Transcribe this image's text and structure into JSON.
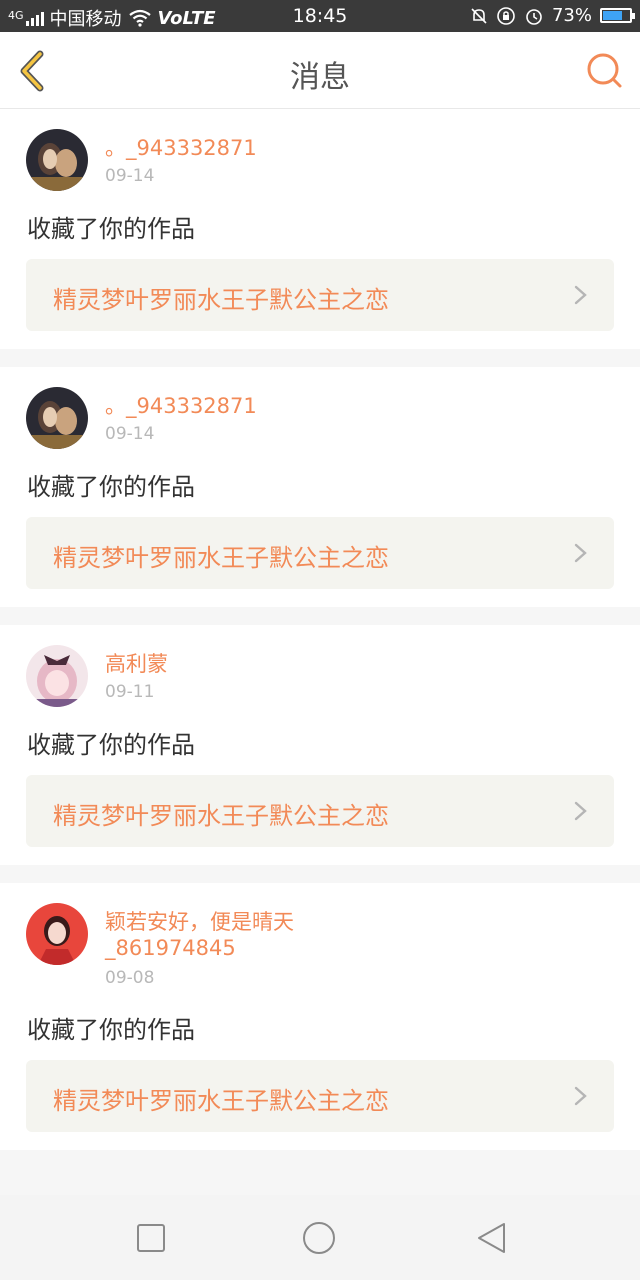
{
  "status_bar": {
    "network_type": "4G",
    "carrier": "中国移动",
    "volte": "VoLTE",
    "time": "18:45",
    "battery_percent": "73%",
    "battery_level": 0.73,
    "icons": [
      "signal-icon",
      "wifi-icon",
      "mute-icon",
      "rotation-lock-icon",
      "alarm-icon",
      "battery-icon"
    ]
  },
  "header": {
    "title": "消息",
    "back_icon": "chevron-left-icon",
    "search_icon": "search-icon"
  },
  "messages": [
    {
      "user": "。_943332871",
      "date": "09-14",
      "action": "收藏了你的作品",
      "work_title": "精灵梦叶罗丽水王子默公主之恋"
    },
    {
      "user": "。_943332871",
      "date": "09-14",
      "action": "收藏了你的作品",
      "work_title": "精灵梦叶罗丽水王子默公主之恋"
    },
    {
      "user": "高利蒙",
      "date": "09-11",
      "action": "收藏了你的作品",
      "work_title": "精灵梦叶罗丽水王子默公主之恋"
    },
    {
      "user": "颖若安好，便是晴天_861974845",
      "date": "09-08",
      "action": "收藏了你的作品",
      "work_title": "精灵梦叶罗丽水王子默公主之恋"
    }
  ],
  "navbar": {
    "icons": [
      "recent-apps-icon",
      "home-icon",
      "back-icon"
    ]
  },
  "colors": {
    "accent": "#f28a57",
    "header_icon": "#f5c542"
  }
}
